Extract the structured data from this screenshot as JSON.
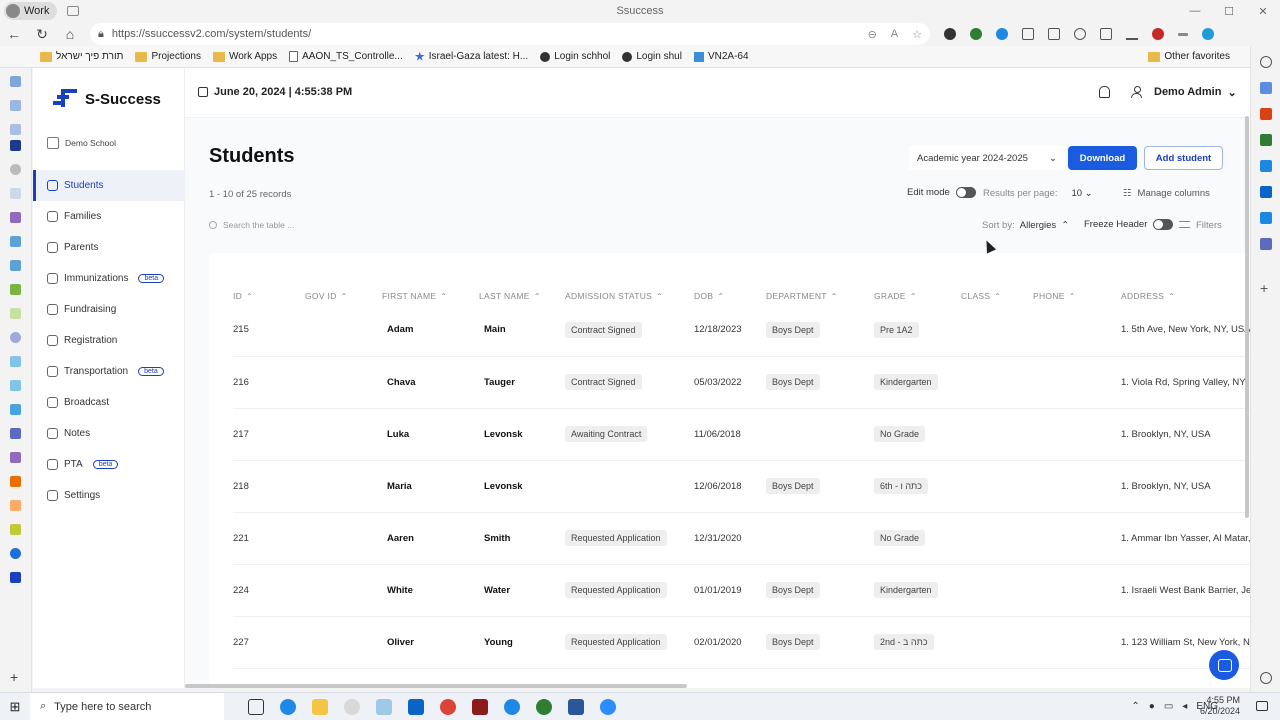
{
  "browser": {
    "profile": "Work",
    "window_title": "Ssuccess",
    "url": "https://ssuccessv2.com/system/students/",
    "favorites": [
      {
        "label": "תורת פיך ישראל",
        "type": "folder"
      },
      {
        "label": "Projections",
        "type": "folder"
      },
      {
        "label": "Work Apps",
        "type": "folder"
      },
      {
        "label": "AAON_TS_Controlle...",
        "type": "page"
      },
      {
        "label": "Israel-Gaza latest: H...",
        "type": "star"
      },
      {
        "label": "Login schhol",
        "type": "dot"
      },
      {
        "label": "Login shul",
        "type": "dot"
      },
      {
        "label": "VN2A-64",
        "type": "square"
      }
    ],
    "other_favorites": "Other favorites"
  },
  "app": {
    "brand": "S-Success",
    "school": "Demo School",
    "date": "June 20, 2024 | 4:55:38 PM",
    "user": "Demo Admin",
    "nav": [
      {
        "label": "Students",
        "active": true,
        "beta": ""
      },
      {
        "label": "Families",
        "active": false,
        "beta": ""
      },
      {
        "label": "Parents",
        "active": false,
        "beta": ""
      },
      {
        "label": "Immunizations",
        "active": false,
        "beta": "beta"
      },
      {
        "label": "Fundraising",
        "active": false,
        "beta": ""
      },
      {
        "label": "Registration",
        "active": false,
        "beta": ""
      },
      {
        "label": "Transportation",
        "active": false,
        "beta": "beta"
      },
      {
        "label": "Broadcast",
        "active": false,
        "beta": ""
      },
      {
        "label": "Notes",
        "active": false,
        "beta": ""
      },
      {
        "label": "PTA",
        "active": false,
        "beta": "beta"
      },
      {
        "label": "Settings",
        "active": false,
        "beta": ""
      }
    ]
  },
  "page": {
    "title": "Students",
    "academic_year": "Academic year 2024-2025",
    "download": "Download",
    "add_student": "Add student",
    "records": "1 - 10 of 25 records",
    "edit_mode": "Edit mode",
    "results_per_page_label": "Results per page:",
    "results_per_page": "10",
    "manage_columns": "Manage columns",
    "search_placeholder": "Search the table ...",
    "sort_by_label": "Sort by:",
    "sort_by_value": "Allergies",
    "freeze_header": "Freeze Header",
    "filters": "Filters"
  },
  "table": {
    "columns": [
      "ID",
      "GOV ID",
      "FIRST NAME",
      "LAST NAME",
      "ADMISSION STATUS",
      "DOB",
      "DEPARTMENT",
      "GRADE",
      "CLASS",
      "PHONE",
      "ADDRESS"
    ],
    "rows": [
      {
        "id": "215",
        "gov": "",
        "first": "Adam",
        "last": "Main",
        "status": "Contract Signed",
        "dob": "12/18/2023",
        "dept": "Boys Dept",
        "grade": "Pre 1A2",
        "class": "",
        "phone": "",
        "address": "1. 5th Ave, New York, NY, USA"
      },
      {
        "id": "216",
        "gov": "",
        "first": "Chava",
        "last": "Tauger",
        "status": "Contract Signed",
        "dob": "05/03/2022",
        "dept": "Boys Dept",
        "grade": "Kindergarten",
        "class": "",
        "phone": "",
        "address": "1. Viola Rd, Spring Valley, NY, U"
      },
      {
        "id": "217",
        "gov": "",
        "first": "Luka",
        "last": "Levonsk",
        "status": "Awaiting Contract",
        "dob": "11/06/2018",
        "dept": "",
        "grade": "No Grade",
        "class": "",
        "phone": "",
        "address": "1. Brooklyn, NY, USA"
      },
      {
        "id": "218",
        "gov": "",
        "first": "Maria",
        "last": "Levonsk",
        "status": "",
        "dob": "12/06/2018",
        "dept": "Boys Dept",
        "grade": "6th - כתה ו",
        "class": "",
        "phone": "",
        "address": "1. Brooklyn, NY, USA"
      },
      {
        "id": "221",
        "gov": "",
        "first": "Aaren",
        "last": "Smith",
        "status": "Requested Application",
        "dob": "12/31/2020",
        "dept": "",
        "grade": "No Grade",
        "class": "",
        "phone": "",
        "address": "1. Ammar Ibn Yasser, Al Matar,"
      },
      {
        "id": "224",
        "gov": "",
        "first": "White",
        "last": "Water",
        "status": "Requested Application",
        "dob": "01/01/2019",
        "dept": "Boys Dept",
        "grade": "Kindergarten",
        "class": "",
        "phone": "",
        "address": "1. Israeli West Bank Barrier, Jer"
      },
      {
        "id": "227",
        "gov": "",
        "first": "Oliver",
        "last": "Young",
        "status": "Requested Application",
        "dob": "02/01/2020",
        "dept": "Boys Dept",
        "grade": "2nd - כתה ב",
        "class": "",
        "phone": "",
        "address": "1. 123 William St, New York, NY 1"
      }
    ]
  },
  "taskbar": {
    "search_placeholder": "Type here to search",
    "language": "ENG",
    "time": "4:55 PM",
    "date": "6/20/2024"
  },
  "colors": {
    "accent": "#1a5be0",
    "brand": "#1a3fbf"
  }
}
